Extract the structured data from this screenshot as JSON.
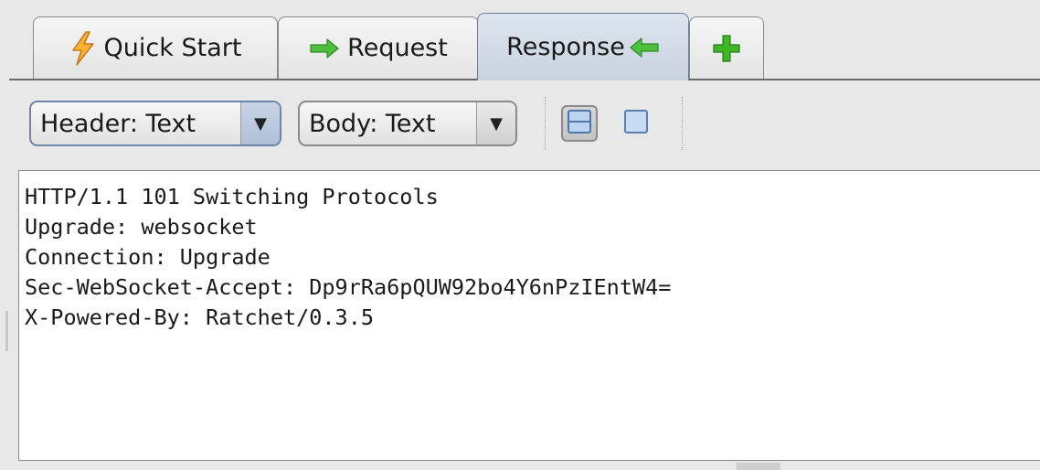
{
  "tabs": [
    {
      "label": "Quick Start",
      "icon": "lightning-bolt-icon"
    },
    {
      "label": "Request",
      "icon": "arrow-right-icon"
    },
    {
      "label": "Response",
      "icon": "arrow-left-icon",
      "active": true
    },
    {
      "label": "",
      "icon": "plus-icon"
    }
  ],
  "toolbar": {
    "header_select": {
      "value": "Header: Text"
    },
    "body_select": {
      "value": "Body: Text"
    },
    "layout_buttons": [
      "split-view-icon",
      "single-view-icon"
    ]
  },
  "response": {
    "lines": [
      "HTTP/1.1 101 Switching Protocols",
      "Upgrade: websocket",
      "Connection: Upgrade",
      "Sec-WebSocket-Accept: Dp9rRa6pQUW92bo4Y6nPzIEntW4=",
      "X-Powered-By: Ratchet/0.3.5"
    ]
  },
  "colors": {
    "active_tab": "#c8d3e0",
    "arrow_green": "#3fae2a",
    "bolt_orange": "#f0a020",
    "plus_green": "#3cb825"
  }
}
